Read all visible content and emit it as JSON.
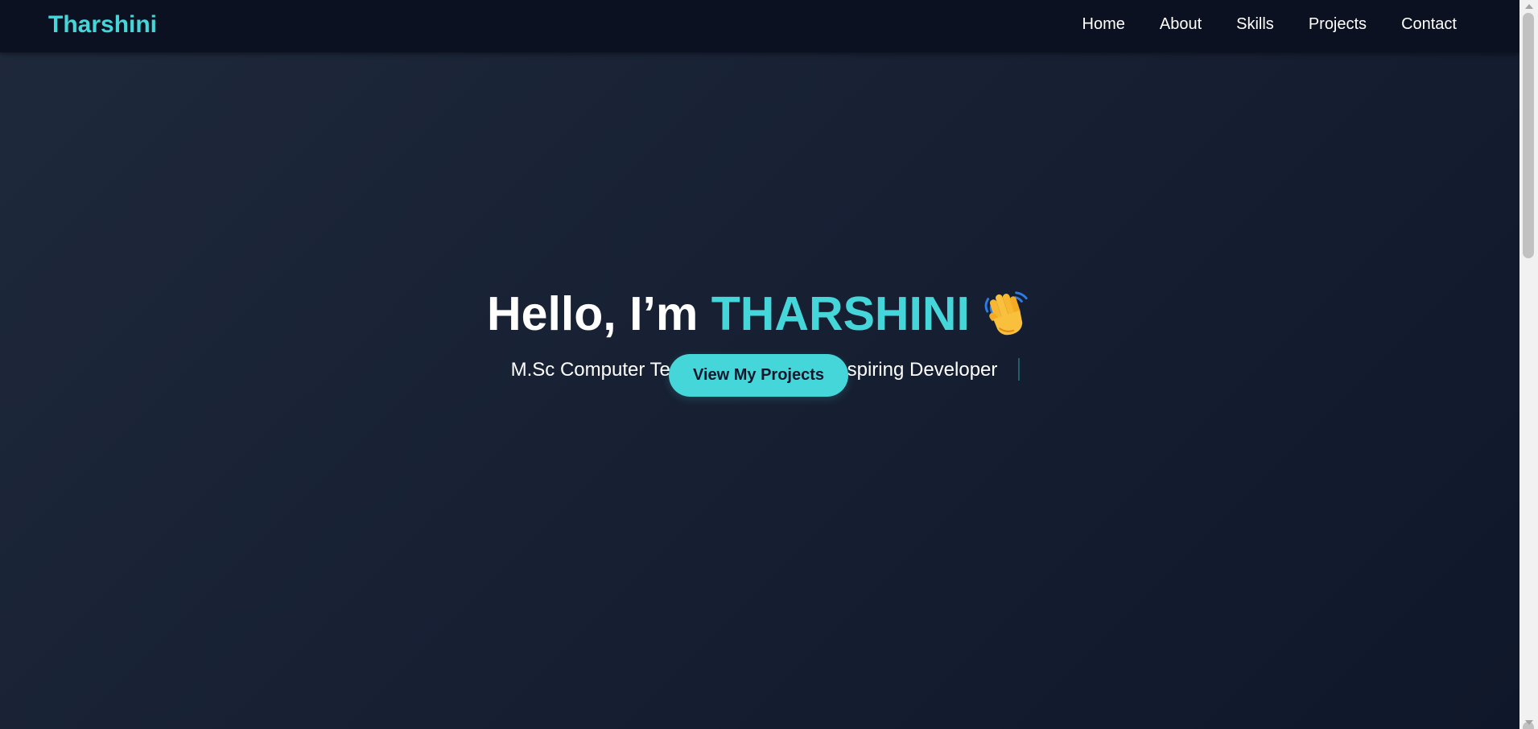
{
  "navbar": {
    "brand": "Tharshini",
    "links": [
      {
        "label": "Home"
      },
      {
        "label": "About"
      },
      {
        "label": "Skills"
      },
      {
        "label": "Projects"
      },
      {
        "label": "Contact"
      }
    ]
  },
  "hero": {
    "greeting": "Hello, I’m ",
    "name": "THARSHINI",
    "wave_icon": "waving-hand-icon",
    "subtitle": "M.Sc Computer Technology Student | Aspiring Developer",
    "cta_label": "View My Projects"
  },
  "colors": {
    "accent": "#45d6d9",
    "background": "#1e293b",
    "navbar_background": "#0b1120",
    "text": "#ffffff"
  }
}
